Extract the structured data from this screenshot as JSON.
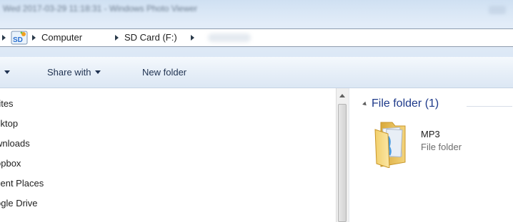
{
  "window": {
    "title": "Wed 2017-03-29 11:18:31 - Windows Photo Viewer"
  },
  "address": {
    "icon": "sd-card-icon",
    "breadcrumbs": [
      "Computer",
      "SD Card (F:)"
    ]
  },
  "toolbar": {
    "organize_caret": "▼",
    "share_with": "Share with",
    "new_folder": "New folder"
  },
  "nav_pane": {
    "items": [
      "rites",
      "sktop",
      "wnloads",
      "opbox",
      "cent Places",
      "ogle Drive"
    ]
  },
  "content": {
    "group_header": "File folder (1)",
    "items": [
      {
        "name": "MP3",
        "type": "File folder",
        "icon": "folder-icon"
      }
    ]
  },
  "colors": {
    "accent": "#1e3a8a",
    "toolbar_text": "#1e3150",
    "secondary_text": "#6d6d6d"
  }
}
